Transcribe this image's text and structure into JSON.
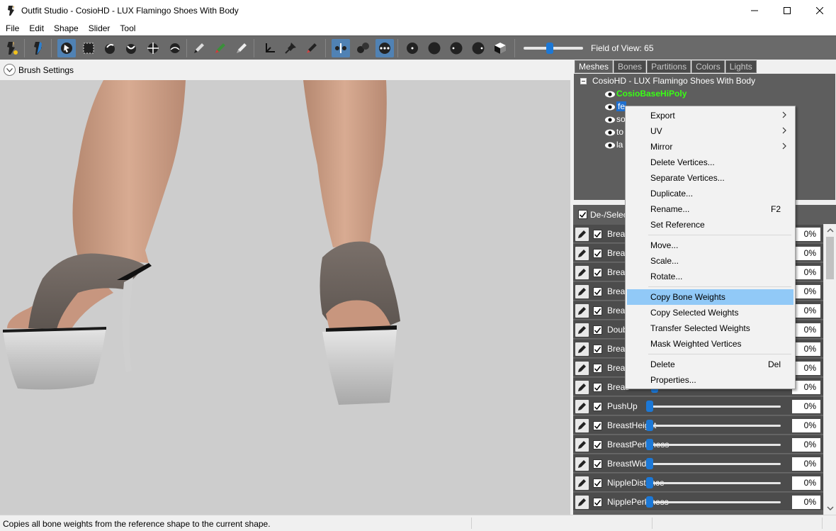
{
  "window": {
    "title": "Outfit Studio - CosioHD - LUX Flamingo Shoes With Body",
    "icon": "outfit-studio-icon"
  },
  "menubar": [
    "File",
    "Edit",
    "Shape",
    "Slider",
    "Tool"
  ],
  "toolbar": {
    "fov_label": "Field of View: 65",
    "fov_value": 65
  },
  "brush_settings": {
    "label": "Brush Settings"
  },
  "tabs": [
    {
      "label": "Meshes",
      "active": true
    },
    {
      "label": "Bones",
      "active": false
    },
    {
      "label": "Partitions",
      "active": false
    },
    {
      "label": "Colors",
      "active": false
    },
    {
      "label": "Lights",
      "active": false
    }
  ],
  "mesh_tree": {
    "root": "CosioHD - LUX Flamingo Shoes With Body",
    "items": [
      {
        "label": "CosioBaseHiPoly",
        "reference": true
      },
      {
        "label": "feet",
        "visible_text": "fe",
        "selected": true
      },
      {
        "label": "so",
        "visible_text": "so"
      },
      {
        "label": "to",
        "visible_text": "to"
      },
      {
        "label": "la",
        "visible_text": "la"
      }
    ]
  },
  "slider_header": {
    "label": "De-/Selec"
  },
  "sliders": [
    {
      "name": "Breas",
      "value": "0%",
      "pos": 0.06
    },
    {
      "name": "Breas",
      "value": "0%",
      "pos": 0.06
    },
    {
      "name": "Breas",
      "value": "0%",
      "pos": 0.06
    },
    {
      "name": "Breas",
      "value": "0%",
      "pos": 0.06
    },
    {
      "name": "Breas",
      "value": "0%",
      "pos": 0.06
    },
    {
      "name": "Doub",
      "value": "0%",
      "pos": 0.06
    },
    {
      "name": "Breas",
      "value": "0%",
      "pos": 0.06
    },
    {
      "name": "Breas",
      "value": "0%",
      "pos": 0.06
    },
    {
      "name": "Breas",
      "value": "0%",
      "pos": 0.06
    },
    {
      "name": "PushUp",
      "value": "0%",
      "pos": 0.02
    },
    {
      "name": "BreastHeight",
      "value": "0%",
      "pos": 0.02
    },
    {
      "name": "BreastPerkiness",
      "value": "0%",
      "pos": 0.02
    },
    {
      "name": "BreastWidth",
      "value": "0%",
      "pos": 0.02
    },
    {
      "name": "NippleDistance",
      "value": "0%",
      "pos": 0.02
    },
    {
      "name": "NipplePerkiness",
      "value": "0%",
      "pos": 0.02
    }
  ],
  "context_menu": {
    "items": [
      {
        "label": "Export",
        "submenu": true
      },
      {
        "label": "UV",
        "submenu": true
      },
      {
        "label": "Mirror",
        "submenu": true
      },
      {
        "label": "Delete Vertices..."
      },
      {
        "label": "Separate Vertices..."
      },
      {
        "label": "Duplicate..."
      },
      {
        "label": "Rename...",
        "shortcut": "F2"
      },
      {
        "label": "Set Reference"
      },
      {
        "separator": true
      },
      {
        "label": "Move..."
      },
      {
        "label": "Scale..."
      },
      {
        "label": "Rotate..."
      },
      {
        "separator": true
      },
      {
        "label": "Copy Bone Weights",
        "highlighted": true
      },
      {
        "label": "Copy Selected Weights"
      },
      {
        "label": "Transfer Selected Weights"
      },
      {
        "label": "Mask Weighted Vertices"
      },
      {
        "separator": true
      },
      {
        "label": "Delete",
        "shortcut": "Del"
      },
      {
        "label": "Properties..."
      }
    ]
  },
  "status": {
    "text": "Copies all bone weights from the reference shape to the current shape."
  },
  "colors": {
    "toolbar_bg": "#6a6a6a",
    "panel_bg": "#5e5e5e",
    "viewport_bg": "#cdcdcd",
    "accent": "#1c78d6",
    "reference_mesh": "#39ff14",
    "menu_highlight": "#91c9f7"
  }
}
